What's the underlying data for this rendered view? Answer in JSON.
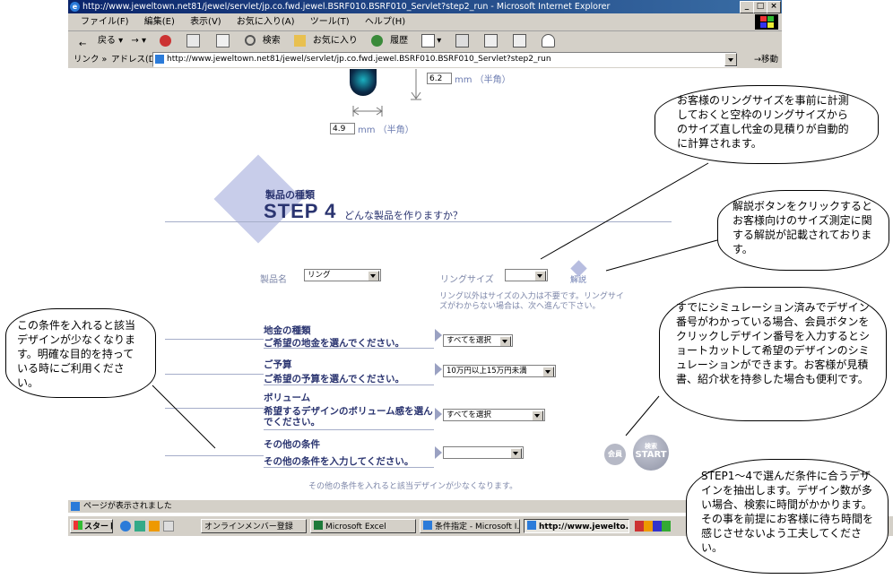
{
  "window": {
    "title": "http://www.jeweltown.net81/jewel/servlet/jp.co.fwd.jewel.BSRF010.BSRF010_Servlet?step2_run - Microsoft Internet Explorer",
    "menu": [
      "ファイル(F)",
      "編集(E)",
      "表示(V)",
      "お気に入り(A)",
      "ツール(T)",
      "ヘルプ(H)"
    ],
    "toolbar": {
      "back": "戻る",
      "search": "検索",
      "favorites": "お気に入り",
      "history": "履歴"
    },
    "address": {
      "links_label": "リンク »",
      "label": "アドレス(D)",
      "url": "http://www.jeweltown.net81/jewel/servlet/jp.co.fwd.jewel.BSRF010.BSRF010_Servlet?step2_run",
      "go": "移動"
    },
    "status": "ページが表示されました"
  },
  "sizes": {
    "height_value": "6.2",
    "width_value": "4.9",
    "unit": "mm （半角）"
  },
  "step": {
    "caption": "製品の種類",
    "title": "STEP 4",
    "subtitle": "どんな製品を作りますか？"
  },
  "product": {
    "label": "製品名",
    "value": "リング",
    "ring_size_label": "リングサイズ",
    "ring_size_value": "",
    "help_label": "解説",
    "note": "リング以外はサイズの入力は不要です。リングサイズがわからない場合は、次へ進んで下さい。"
  },
  "conditions": [
    {
      "title": "地金の種類",
      "desc": "ご希望の地金を選んでください。",
      "value": "すべてを選択"
    },
    {
      "title": "ご予算",
      "desc": "ご希望の予算を選んでください。",
      "value": "10万円以上15万円未満"
    },
    {
      "title": "ボリューム",
      "desc": "希望するデザインのボリューム感を選んでください。",
      "value": "すべてを選択"
    },
    {
      "title": "その他の条件",
      "desc": "その他の条件を入力してください。",
      "value": ""
    }
  ],
  "bottom_note": "その他の条件を入れると該当デザインが少なくなります。",
  "buttons": {
    "member": "会員",
    "search_top": "検索",
    "search_start": "START"
  },
  "taskbar": {
    "start": "スタート",
    "items": [
      "オンラインメンバー登録",
      "Microsoft Excel",
      "条件指定 - Microsoft I...",
      "http://www.jewelto..."
    ]
  },
  "callouts": {
    "ring_size": "お客様のリングサイズを事前に計測しておくと空枠のリングサイズからのサイズ直し代金の見積りが自動的に計算されます。",
    "help": "解説ボタンをクリックするとお客様向けのサイズ測定に関する解説が記載されております。",
    "member": "すでにシミュレーション済みでデザイン番号がわかっている場合、会員ボタンをクリックしデザイン番号を入力するとショートカットして希望のデザインのシミュレーションができます。お客様が見積書、紹介状を持参した場合も便利です。",
    "conditions": "この条件を入れると該当デザインが少なくなります。明確な目的を持っている時にご利用ください。",
    "start": "STEP1～4で選んだ条件に合うデザインを抽出します。デザイン数が多い場合、検索に時間がかかります。その事を前提にお客様に待ち時間を感じさせないよう工夫してください。"
  },
  "colors": {
    "navy": "#2a3470",
    "diamond": "#c8cdea",
    "title_bar": "#0a246a"
  }
}
